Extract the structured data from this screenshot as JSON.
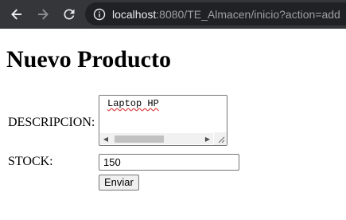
{
  "browser": {
    "url_host": "localhost",
    "url_rest": ":8080/TE_Almacen/inicio?action=add",
    "icons": [
      "back-arrow-icon",
      "forward-arrow-icon",
      "reload-icon",
      "site-info-icon"
    ]
  },
  "page": {
    "title": "Nuevo Producto"
  },
  "form": {
    "description_label": "DESCRIPCION:",
    "description_value": "Laptop HP",
    "stock_label": "STOCK:",
    "stock_value": "150",
    "submit_label": "Enviar"
  },
  "colors": {
    "toolbar_bg": "#35363a",
    "omnibox_bg": "#202124",
    "spellcheck_underline": "#e04545"
  }
}
